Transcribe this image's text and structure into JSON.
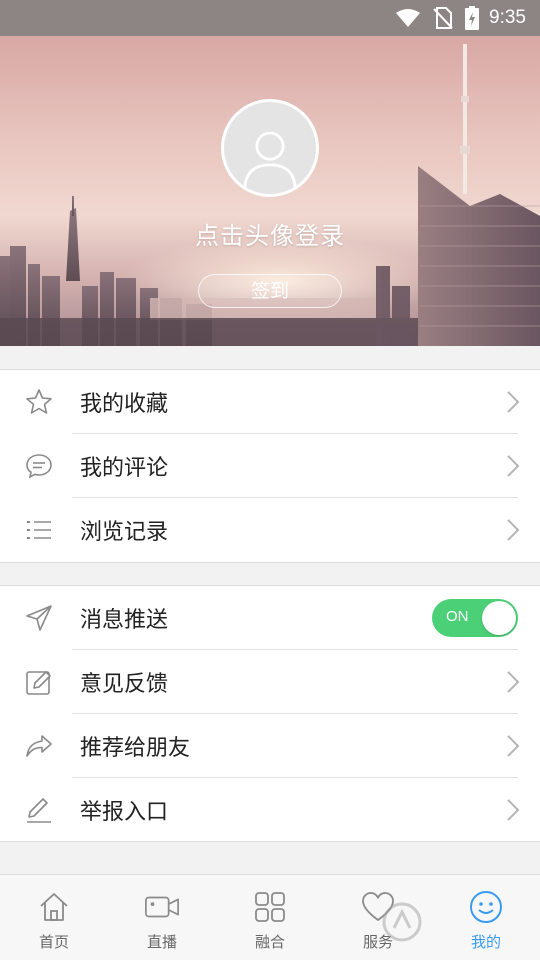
{
  "status_bar": {
    "time": "9:35",
    "icons": [
      "wifi-icon",
      "no-sim-icon",
      "battery-charging-icon"
    ]
  },
  "header": {
    "avatar_icon": "user-avatar-placeholder-icon",
    "login_prompt": "点击头像登录",
    "checkin_label": "签到"
  },
  "menu_group_1": [
    {
      "label": "我的收藏",
      "icon": "star-icon"
    },
    {
      "label": "我的评论",
      "icon": "comment-icon"
    },
    {
      "label": "浏览记录",
      "icon": "list-icon"
    }
  ],
  "menu_group_2": [
    {
      "label": "消息推送",
      "icon": "send-icon",
      "toggle": "ON",
      "toggle_state": true
    },
    {
      "label": "意见反馈",
      "icon": "edit-box-icon"
    },
    {
      "label": "推荐给朋友",
      "icon": "share-icon"
    },
    {
      "label": "举报入口",
      "icon": "pencil-icon"
    }
  ],
  "bottom_nav": [
    {
      "label": "首页",
      "icon": "home-icon"
    },
    {
      "label": "直播",
      "icon": "video-camera-icon"
    },
    {
      "label": "融合",
      "icon": "grid-icon"
    },
    {
      "label": "服务",
      "icon": "heart-icon"
    },
    {
      "label": "我的",
      "icon": "smiley-icon",
      "active": true
    }
  ],
  "colors": {
    "accent_blue": "#3a9cf0",
    "toggle_green": "#4cd077",
    "text": "#222222",
    "icon_gray": "#8a8a8a"
  }
}
